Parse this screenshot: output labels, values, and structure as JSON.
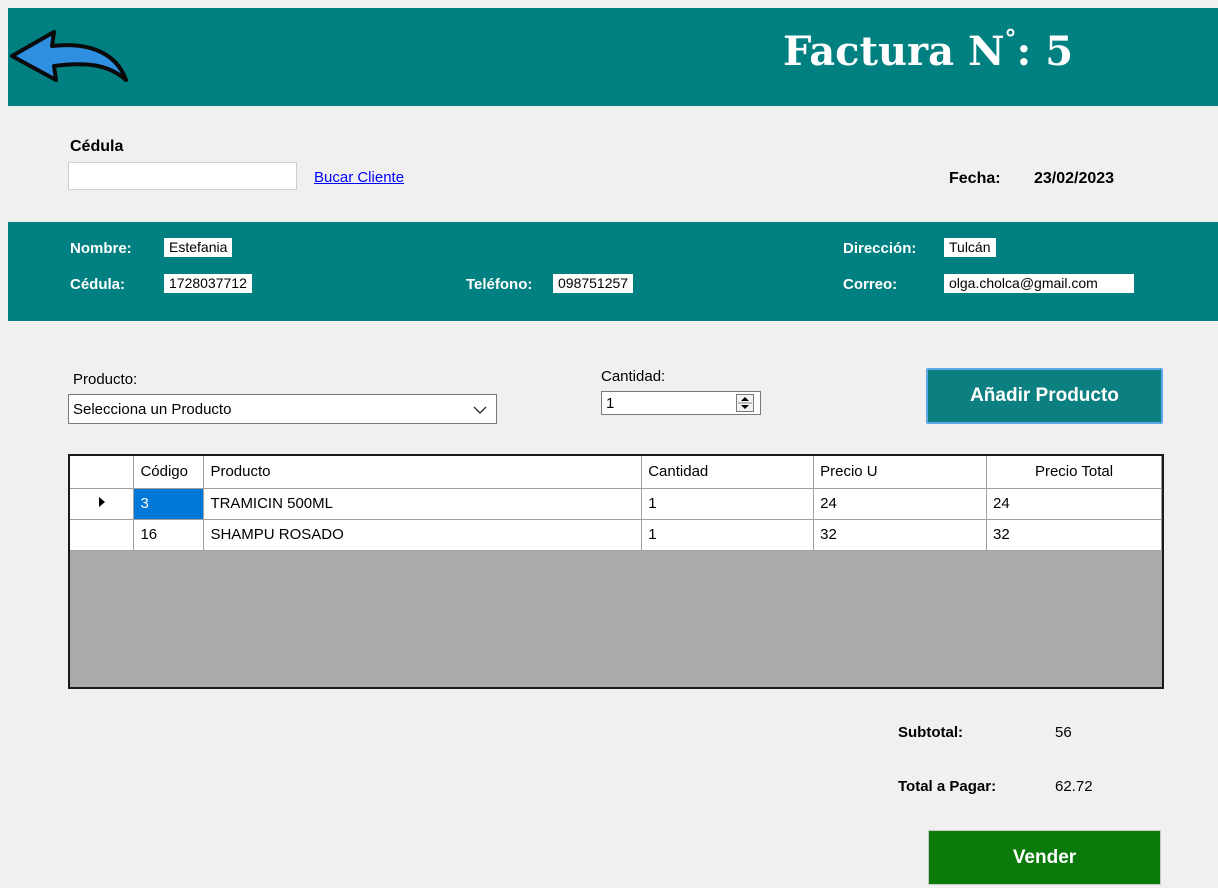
{
  "header": {
    "title": "Factura N",
    "number_sign": "°",
    "number": ": 5",
    "back_icon": "back-arrow-icon",
    "bg_color": "#008080"
  },
  "search": {
    "cedula_label": "Cédula",
    "cedula_value": "",
    "search_link": "Bucar Cliente"
  },
  "date": {
    "label": "Fecha:",
    "value": "23/02/2023"
  },
  "client": {
    "nombre_label": "Nombre:",
    "nombre_value": "Estefania",
    "cedula_label": "Cédula:",
    "cedula_value": "1728037712",
    "telefono_label": "Teléfono:",
    "telefono_value": "098751257",
    "direccion_label": "Dirección:",
    "direccion_value": "Tulcán",
    "correo_label": "Correo:",
    "correo_value": "olga.cholca@gmail.com"
  },
  "product_form": {
    "producto_label": "Producto:",
    "producto_selected": "Selecciona un Producto",
    "cantidad_label": "Cantidad:",
    "cantidad_value": "1",
    "add_button": "Añadir Producto"
  },
  "grid": {
    "columns": [
      "Código",
      "Producto",
      "Cantidad",
      "Precio U",
      "Precio Total"
    ],
    "rows": [
      {
        "codigo": "3",
        "producto": "TRAMICIN  500ML",
        "cantidad": "1",
        "precio_u": "24",
        "precio_total": "24"
      },
      {
        "codigo": "16",
        "producto": "SHAMPU ROSADO",
        "cantidad": "1",
        "precio_u": "32",
        "precio_total": "32"
      }
    ],
    "current_row_icon": "row-pointer-icon"
  },
  "totals": {
    "subtotal_label": "Subtotal:",
    "subtotal_value": "56",
    "total_label": "Total a Pagar:",
    "total_value": "62.72"
  },
  "actions": {
    "sell_button": "Vender",
    "sell_color": "#0a7b0a"
  }
}
